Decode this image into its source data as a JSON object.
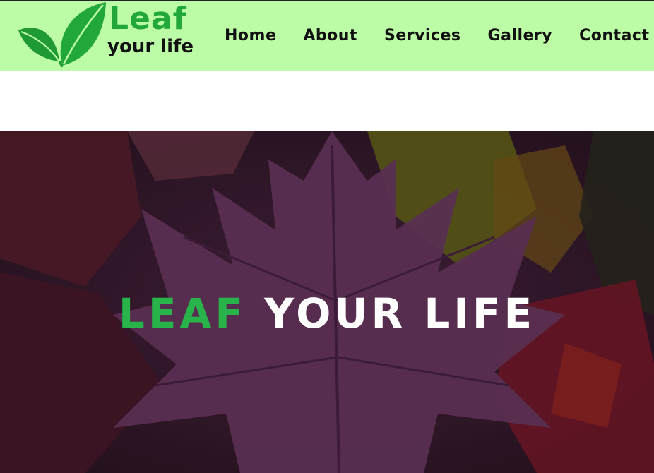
{
  "brand": {
    "logo_line1": "Leaf",
    "logo_line2": "your life",
    "logo_color": "#22a73c",
    "navbar_color": "#bdfca6"
  },
  "nav": {
    "items": [
      {
        "label": "Home"
      },
      {
        "label": "About"
      },
      {
        "label": "Services"
      },
      {
        "label": "Gallery"
      },
      {
        "label": "Contact"
      }
    ]
  },
  "hero": {
    "title_accent": "LEAF",
    "title_rest": "YOUR LIFE",
    "accent_color": "#28b44a"
  }
}
